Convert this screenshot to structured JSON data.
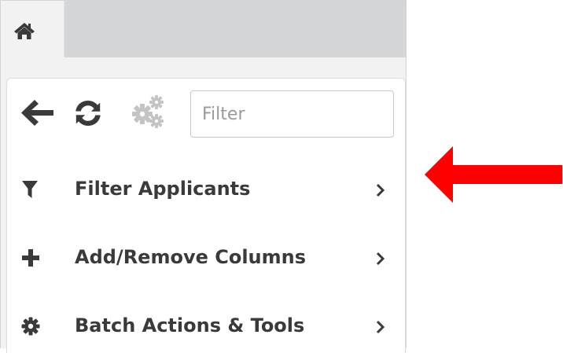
{
  "tabs": {
    "home_icon": "home-icon"
  },
  "toolbar": {
    "back_icon": "arrow-left-icon",
    "refresh_icon": "refresh-icon",
    "settings_icon": "gears-icon",
    "filter_placeholder": "Filter"
  },
  "menu": {
    "items": [
      {
        "label": "Filter Applicants",
        "icon": "filter-icon"
      },
      {
        "label": "Add/Remove Columns",
        "icon": "plus-icon"
      },
      {
        "label": "Batch Actions & Tools",
        "icon": "gear-icon"
      }
    ]
  },
  "annotation": {
    "arrow_color": "#ff0000"
  },
  "colors": {
    "icon_dark": "#3a3a3a",
    "icon_disabled": "#c4c4c4",
    "tabbar_bg": "#d4d6d8"
  }
}
